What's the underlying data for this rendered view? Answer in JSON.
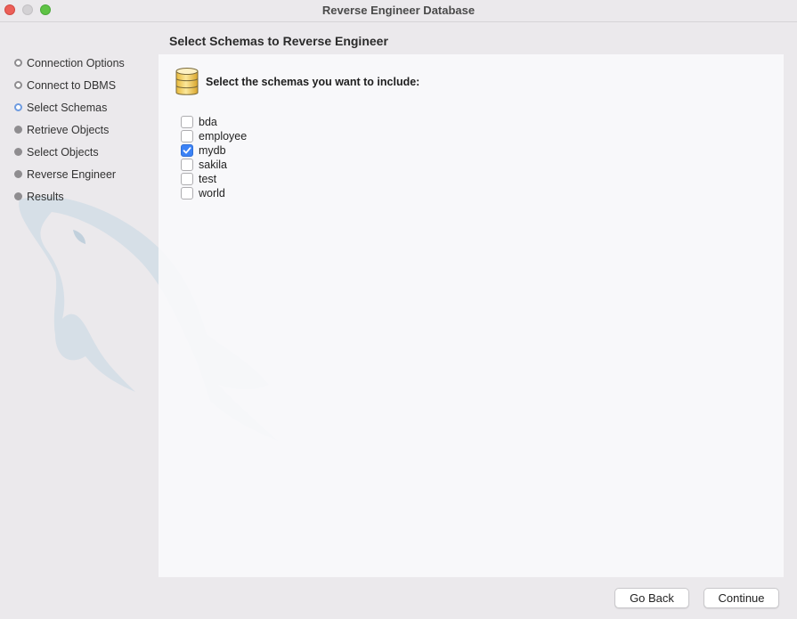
{
  "window": {
    "title": "Reverse Engineer Database"
  },
  "sidebar": {
    "steps": [
      {
        "label": "Connection Options",
        "state": "done"
      },
      {
        "label": "Connect to DBMS",
        "state": "done"
      },
      {
        "label": "Select Schemas",
        "state": "active"
      },
      {
        "label": "Retrieve Objects",
        "state": "pending"
      },
      {
        "label": "Select Objects",
        "state": "pending"
      },
      {
        "label": "Reverse Engineer",
        "state": "pending"
      },
      {
        "label": "Results",
        "state": "pending"
      }
    ]
  },
  "page": {
    "heading": "Select Schemas to Reverse Engineer",
    "instruction": "Select the schemas you want to include:",
    "icon": "database-icon"
  },
  "schemas": [
    {
      "name": "bda",
      "checked": false
    },
    {
      "name": "employee",
      "checked": false
    },
    {
      "name": "mydb",
      "checked": true
    },
    {
      "name": "sakila",
      "checked": false
    },
    {
      "name": "test",
      "checked": false
    },
    {
      "name": "world",
      "checked": false
    }
  ],
  "buttons": {
    "back_label": "Go Back",
    "continue_label": "Continue"
  },
  "colors": {
    "accent": "#3b82f6",
    "close": "#ec5f58",
    "maximize": "#5fc345",
    "window_bg": "#ebe9ec",
    "panel_bg": "#f9f9fb"
  }
}
